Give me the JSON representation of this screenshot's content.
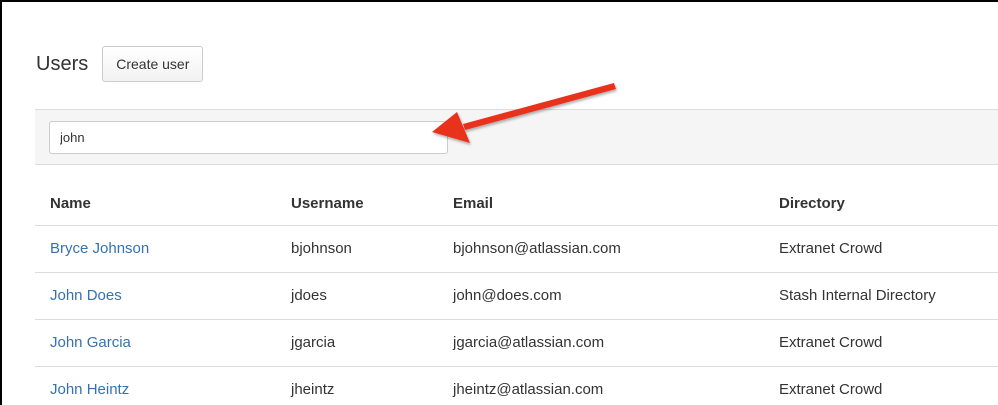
{
  "header": {
    "title": "Users",
    "create_user_label": "Create user"
  },
  "filter": {
    "value": "john",
    "placeholder": ""
  },
  "annotation": {
    "arrow_color": "#e8321c"
  },
  "table": {
    "columns": [
      "Name",
      "Username",
      "Email",
      "Directory"
    ],
    "rows": [
      {
        "name": "Bryce Johnson",
        "username": "bjohnson",
        "email": "bjohnson@atlassian.com",
        "directory": "Extranet Crowd"
      },
      {
        "name": "John Does",
        "username": "jdoes",
        "email": "john@does.com",
        "directory": "Stash Internal Directory"
      },
      {
        "name": "John Garcia",
        "username": "jgarcia",
        "email": "jgarcia@atlassian.com",
        "directory": "Extranet Crowd"
      },
      {
        "name": "John Heintz",
        "username": "jheintz",
        "email": "jheintz@atlassian.com",
        "directory": "Extranet Crowd"
      }
    ]
  },
  "colors": {
    "link": "#3572b0",
    "text": "#333333",
    "filter_bar_bg": "#f5f5f5"
  }
}
